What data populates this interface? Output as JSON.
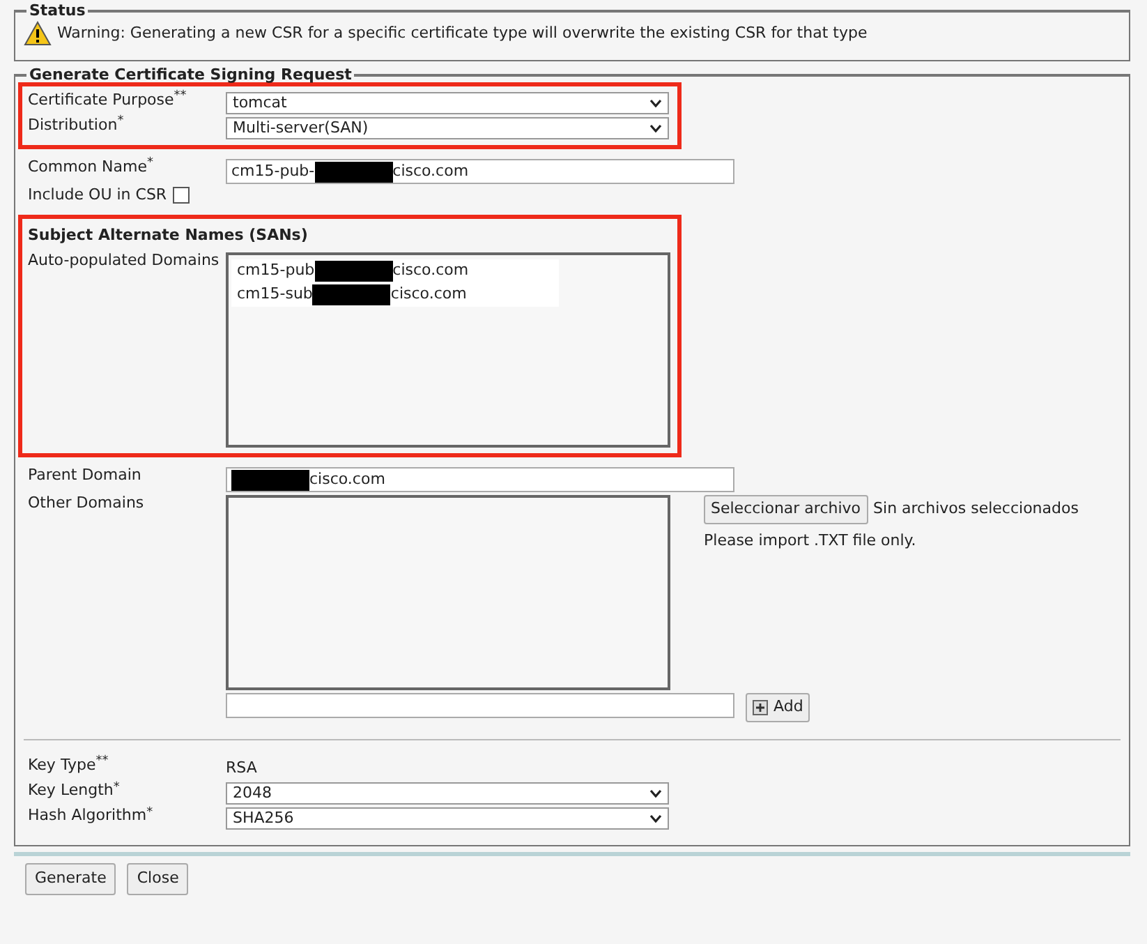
{
  "status": {
    "legend": "Status",
    "message": "Warning: Generating a new CSR for a specific certificate type will overwrite the existing CSR for that type"
  },
  "form": {
    "legend": "Generate Certificate Signing Request",
    "groups": [
      {
        "highlighted": true,
        "rows": [
          {
            "kind": "select",
            "label": "Certificate Purpose$^{**}$",
            "value": "tomcat"
          },
          {
            "kind": "select",
            "label": "Distribution$^{*}$",
            "value": "Multi-server(SAN)"
          }
        ]
      },
      {
        "highlighted": false,
        "rows": [
          {
            "kind": "text",
            "label": "Common Name$^{*}$",
            "parts": [
              {
                "kind": "text",
                "text": "cm15-pub-"
              },
              {
                "kind": "redaction"
              },
              {
                "kind": "text",
                "text": "cisco.com"
              }
            ]
          },
          {
            "kind": "checkbox",
            "label": "Include OU in CSR",
            "checked": false
          }
        ]
      },
      {
        "highlighted": true,
        "heading": "Subject Alternate Names (SANs)",
        "rows": [
          {
            "kind": "listbox",
            "label": "Auto-populated Domains",
            "entries": [
              [
                {
                  "kind": "text",
                  "text": "cm15-pub"
                },
                {
                  "kind": "redaction"
                },
                {
                  "kind": "text",
                  "text": "cisco.com"
                }
              ],
              [
                {
                  "kind": "text",
                  "text": "cm15-sub"
                },
                {
                  "kind": "redaction"
                },
                {
                  "kind": "text",
                  "text": "cisco.com"
                }
              ]
            ]
          }
        ]
      },
      {
        "highlighted": false,
        "rows": [
          {
            "kind": "text",
            "label": "Parent Domain",
            "parts": [
              {
                "kind": "redaction"
              },
              {
                "kind": "text",
                "text": "cisco.com"
              }
            ]
          },
          {
            "kind": "textarea",
            "label": "Other Domains",
            "file_button": "Seleccionar archivo",
            "file_status": "Sin archivos seleccionados",
            "hint": "Please import .TXT file only."
          },
          {
            "kind": "add",
            "label": "",
            "button": "Add"
          }
        ]
      },
      {
        "highlighted": false,
        "divider": true,
        "rows": [
          {
            "kind": "static",
            "label": "Key Type$^{**}$",
            "value": "RSA"
          },
          {
            "kind": "select",
            "label": "Key Length$^{*}$",
            "value": "2048"
          },
          {
            "kind": "select",
            "label": "Hash Algorithm$^{*}$",
            "value": "SHA256"
          }
        ]
      }
    ]
  },
  "buttons": [
    "Generate",
    "Close"
  ]
}
